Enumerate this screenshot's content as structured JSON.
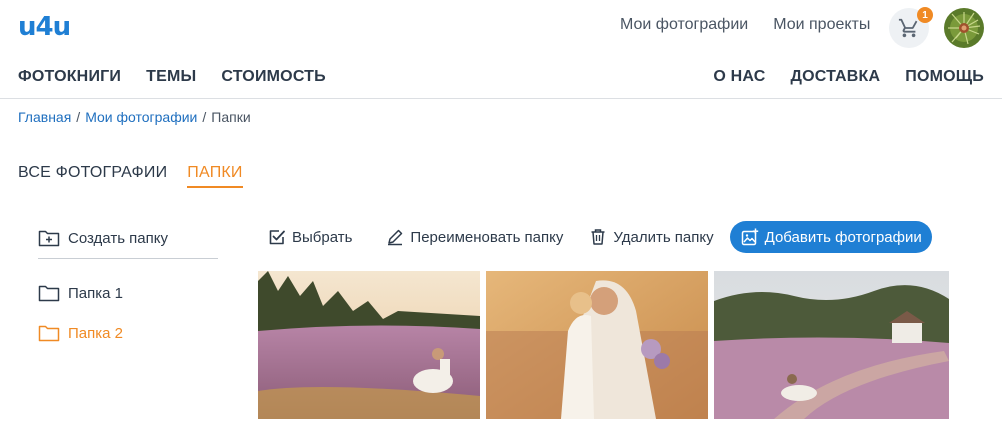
{
  "header": {
    "logo": "u4u",
    "top_links": [
      "Мои фотографии",
      "Мои проекты"
    ],
    "cart_count": "1"
  },
  "main_nav": {
    "left": [
      "ФОТОКНИГИ",
      "ТЕМЫ",
      "СТОИМОСТЬ"
    ],
    "right": [
      "О НАС",
      "ДОСТАВКА",
      "ПОМОЩЬ"
    ]
  },
  "breadcrumb": {
    "items": [
      "Главная",
      "Мои фотографии",
      "Папки"
    ],
    "separator": "/"
  },
  "tabs": [
    "ВСЕ ФОТОГРАФИИ",
    "ПАПКИ"
  ],
  "sidebar": {
    "create_folder": "Создать папку",
    "folders": [
      "Папка 1",
      "Папка 2"
    ]
  },
  "toolbar": {
    "select": "Выбрать",
    "rename": "Переименовать папку",
    "delete": "Удалить папку",
    "add_photos": "Добавить фотографии"
  },
  "colors": {
    "accent": "#f08a24",
    "primary": "#1f7fd4",
    "text": "#2d3a4a"
  }
}
